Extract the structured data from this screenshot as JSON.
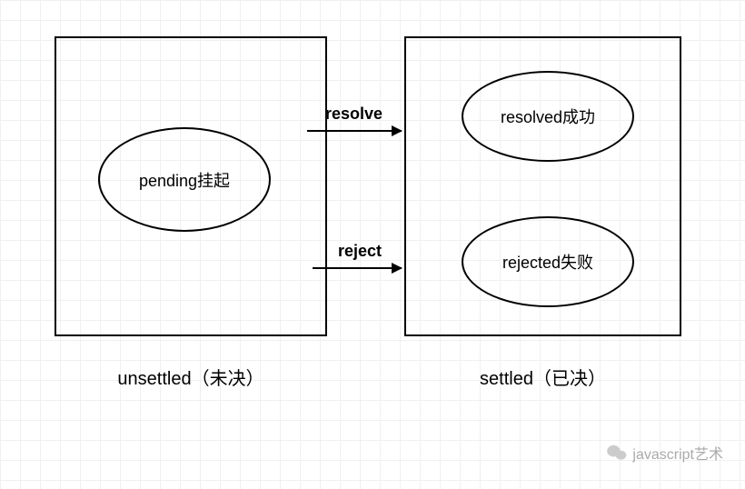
{
  "states": {
    "pending": "pending挂起",
    "resolved": "resolved成功",
    "rejected": "rejected失败"
  },
  "captions": {
    "unsettled": "unsettled（未决）",
    "settled": "settled（已决）"
  },
  "transitions": {
    "resolve": "resolve",
    "reject": "reject"
  },
  "watermark": {
    "text": "javascript艺术"
  }
}
